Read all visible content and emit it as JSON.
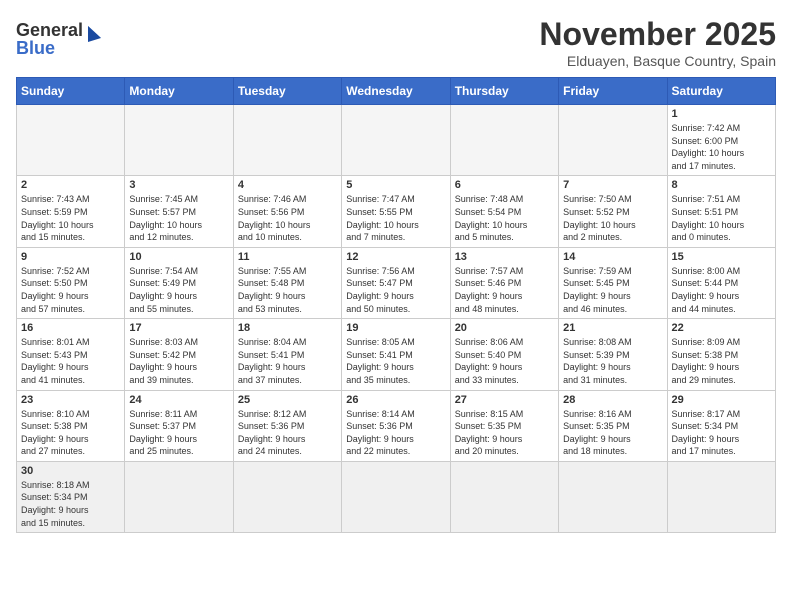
{
  "header": {
    "logo_general": "General",
    "logo_blue": "Blue",
    "title": "November 2025",
    "subtitle": "Elduayen, Basque Country, Spain"
  },
  "weekdays": [
    "Sunday",
    "Monday",
    "Tuesday",
    "Wednesday",
    "Thursday",
    "Friday",
    "Saturday"
  ],
  "days": [
    {
      "num": "",
      "empty": true
    },
    {
      "num": "",
      "empty": true
    },
    {
      "num": "",
      "empty": true
    },
    {
      "num": "",
      "empty": true
    },
    {
      "num": "",
      "empty": true
    },
    {
      "num": "",
      "empty": true
    },
    {
      "num": "1",
      "info": "Sunrise: 7:42 AM\nSunset: 6:00 PM\nDaylight: 10 hours\nand 17 minutes."
    },
    {
      "num": "2",
      "info": "Sunrise: 7:43 AM\nSunset: 5:59 PM\nDaylight: 10 hours\nand 15 minutes."
    },
    {
      "num": "3",
      "info": "Sunrise: 7:45 AM\nSunset: 5:57 PM\nDaylight: 10 hours\nand 12 minutes."
    },
    {
      "num": "4",
      "info": "Sunrise: 7:46 AM\nSunset: 5:56 PM\nDaylight: 10 hours\nand 10 minutes."
    },
    {
      "num": "5",
      "info": "Sunrise: 7:47 AM\nSunset: 5:55 PM\nDaylight: 10 hours\nand 7 minutes."
    },
    {
      "num": "6",
      "info": "Sunrise: 7:48 AM\nSunset: 5:54 PM\nDaylight: 10 hours\nand 5 minutes."
    },
    {
      "num": "7",
      "info": "Sunrise: 7:50 AM\nSunset: 5:52 PM\nDaylight: 10 hours\nand 2 minutes."
    },
    {
      "num": "8",
      "info": "Sunrise: 7:51 AM\nSunset: 5:51 PM\nDaylight: 10 hours\nand 0 minutes."
    },
    {
      "num": "9",
      "info": "Sunrise: 7:52 AM\nSunset: 5:50 PM\nDaylight: 9 hours\nand 57 minutes."
    },
    {
      "num": "10",
      "info": "Sunrise: 7:54 AM\nSunset: 5:49 PM\nDaylight: 9 hours\nand 55 minutes."
    },
    {
      "num": "11",
      "info": "Sunrise: 7:55 AM\nSunset: 5:48 PM\nDaylight: 9 hours\nand 53 minutes."
    },
    {
      "num": "12",
      "info": "Sunrise: 7:56 AM\nSunset: 5:47 PM\nDaylight: 9 hours\nand 50 minutes."
    },
    {
      "num": "13",
      "info": "Sunrise: 7:57 AM\nSunset: 5:46 PM\nDaylight: 9 hours\nand 48 minutes."
    },
    {
      "num": "14",
      "info": "Sunrise: 7:59 AM\nSunset: 5:45 PM\nDaylight: 9 hours\nand 46 minutes."
    },
    {
      "num": "15",
      "info": "Sunrise: 8:00 AM\nSunset: 5:44 PM\nDaylight: 9 hours\nand 44 minutes."
    },
    {
      "num": "16",
      "info": "Sunrise: 8:01 AM\nSunset: 5:43 PM\nDaylight: 9 hours\nand 41 minutes."
    },
    {
      "num": "17",
      "info": "Sunrise: 8:03 AM\nSunset: 5:42 PM\nDaylight: 9 hours\nand 39 minutes."
    },
    {
      "num": "18",
      "info": "Sunrise: 8:04 AM\nSunset: 5:41 PM\nDaylight: 9 hours\nand 37 minutes."
    },
    {
      "num": "19",
      "info": "Sunrise: 8:05 AM\nSunset: 5:41 PM\nDaylight: 9 hours\nand 35 minutes."
    },
    {
      "num": "20",
      "info": "Sunrise: 8:06 AM\nSunset: 5:40 PM\nDaylight: 9 hours\nand 33 minutes."
    },
    {
      "num": "21",
      "info": "Sunrise: 8:08 AM\nSunset: 5:39 PM\nDaylight: 9 hours\nand 31 minutes."
    },
    {
      "num": "22",
      "info": "Sunrise: 8:09 AM\nSunset: 5:38 PM\nDaylight: 9 hours\nand 29 minutes."
    },
    {
      "num": "23",
      "info": "Sunrise: 8:10 AM\nSunset: 5:38 PM\nDaylight: 9 hours\nand 27 minutes."
    },
    {
      "num": "24",
      "info": "Sunrise: 8:11 AM\nSunset: 5:37 PM\nDaylight: 9 hours\nand 25 minutes."
    },
    {
      "num": "25",
      "info": "Sunrise: 8:12 AM\nSunset: 5:36 PM\nDaylight: 9 hours\nand 24 minutes."
    },
    {
      "num": "26",
      "info": "Sunrise: 8:14 AM\nSunset: 5:36 PM\nDaylight: 9 hours\nand 22 minutes."
    },
    {
      "num": "27",
      "info": "Sunrise: 8:15 AM\nSunset: 5:35 PM\nDaylight: 9 hours\nand 20 minutes."
    },
    {
      "num": "28",
      "info": "Sunrise: 8:16 AM\nSunset: 5:35 PM\nDaylight: 9 hours\nand 18 minutes."
    },
    {
      "num": "29",
      "info": "Sunrise: 8:17 AM\nSunset: 5:34 PM\nDaylight: 9 hours\nand 17 minutes."
    },
    {
      "num": "30",
      "info": "Sunrise: 8:18 AM\nSunset: 5:34 PM\nDaylight: 9 hours\nand 15 minutes."
    },
    {
      "num": "",
      "empty": true
    },
    {
      "num": "",
      "empty": true
    },
    {
      "num": "",
      "empty": true
    },
    {
      "num": "",
      "empty": true
    },
    {
      "num": "",
      "empty": true
    },
    {
      "num": "",
      "empty": true
    }
  ]
}
